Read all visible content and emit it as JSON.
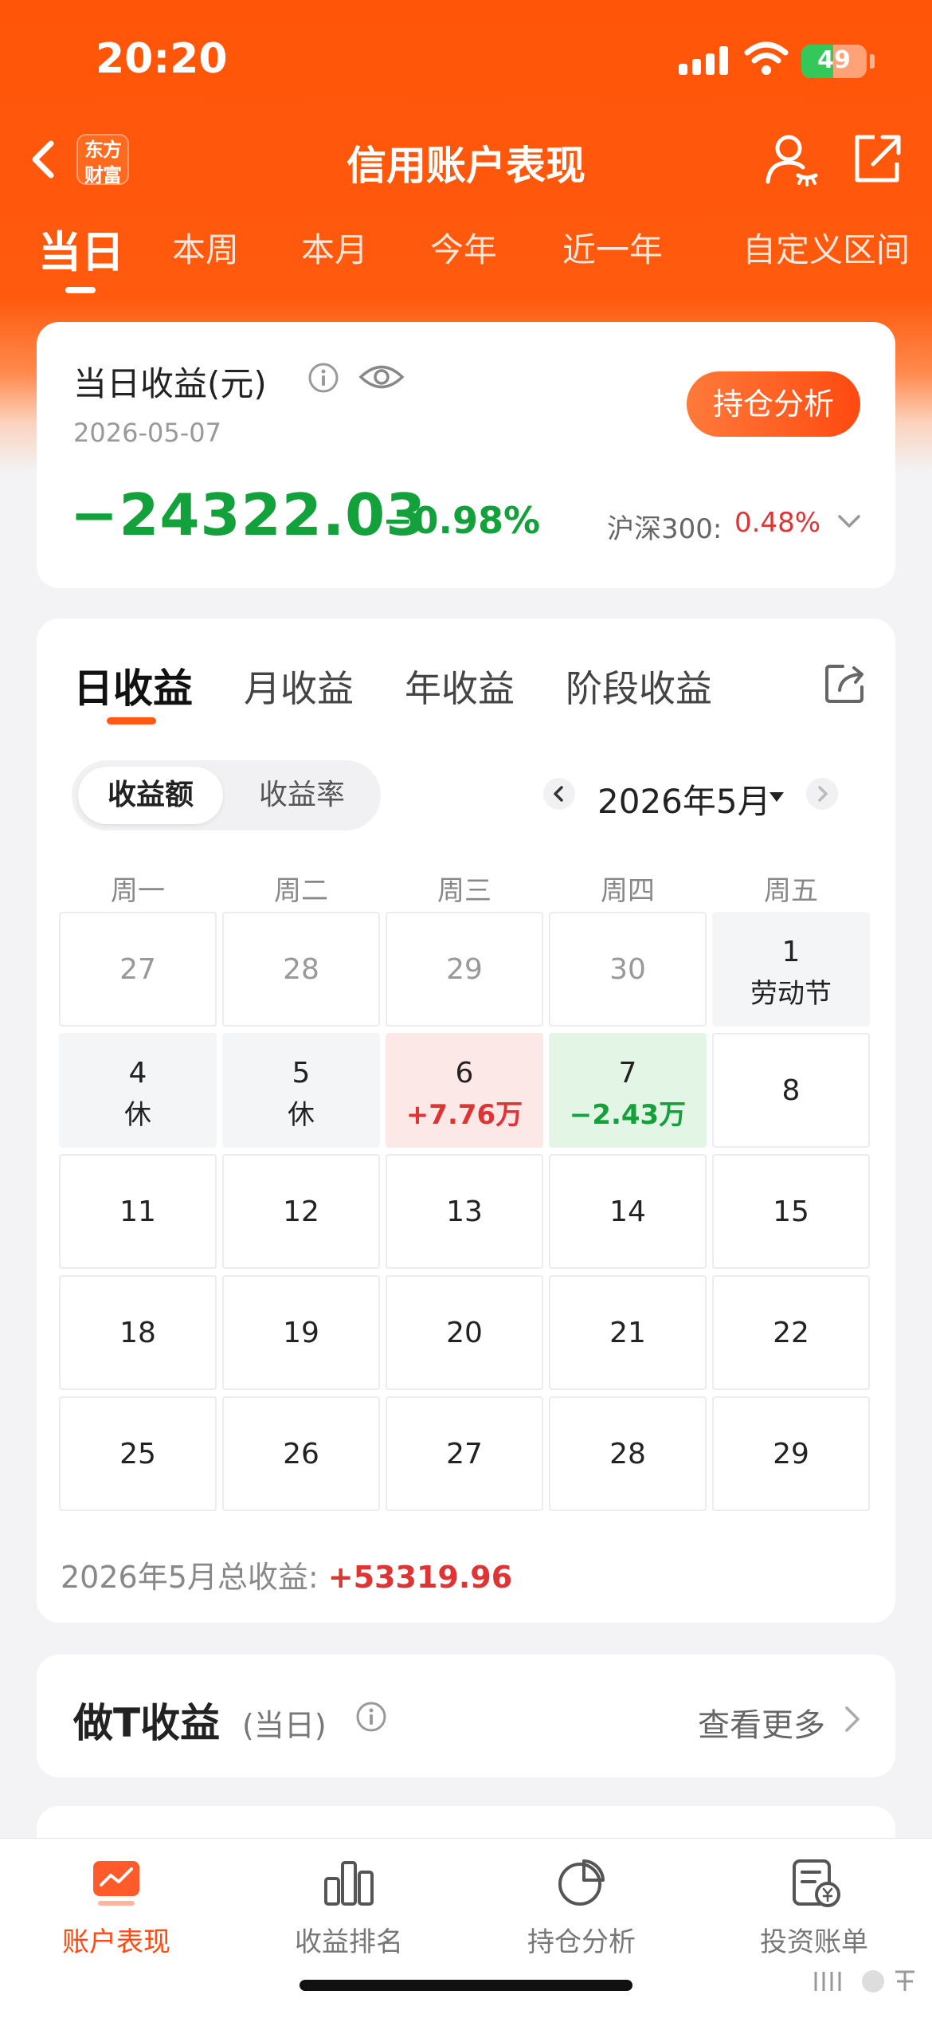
{
  "status_bar": {
    "time": "20:20",
    "battery_percent": "49"
  },
  "nav": {
    "logo_line1": "东方",
    "logo_line2": "财富",
    "title": "信用账户表现"
  },
  "period_tabs": [
    {
      "label": "当日",
      "active": true
    },
    {
      "label": "本周",
      "active": false
    },
    {
      "label": "本月",
      "active": false
    },
    {
      "label": "今年",
      "active": false
    },
    {
      "label": "近一年",
      "active": false
    },
    {
      "label": "自定义区间",
      "active": false
    }
  ],
  "summary": {
    "title": "当日收益(元)",
    "date": "2026-05-07",
    "analyze_button": "持仓分析",
    "amount": "−24322.03",
    "percent": "−0.98%",
    "benchmark_label": "沪深300:",
    "benchmark_value": "0.48%"
  },
  "returns": {
    "tabs": [
      {
        "label": "日收益",
        "active": true
      },
      {
        "label": "月收益",
        "active": false
      },
      {
        "label": "年收益",
        "active": false
      },
      {
        "label": "阶段收益",
        "active": false
      }
    ],
    "segment": [
      {
        "label": "收益额",
        "active": true
      },
      {
        "label": "收益率",
        "active": false
      }
    ],
    "month_label": "2026年5月",
    "weekdays": [
      "周一",
      "周二",
      "周三",
      "周四",
      "周五"
    ],
    "weeks": [
      [
        {
          "day": "27",
          "sub": "",
          "style": "muted"
        },
        {
          "day": "28",
          "sub": "",
          "style": "muted"
        },
        {
          "day": "29",
          "sub": "",
          "style": "muted"
        },
        {
          "day": "30",
          "sub": "",
          "style": "muted"
        },
        {
          "day": "1",
          "sub": "劳动节",
          "style": "grey"
        }
      ],
      [
        {
          "day": "4",
          "sub": "休",
          "style": "grey"
        },
        {
          "day": "5",
          "sub": "休",
          "style": "grey"
        },
        {
          "day": "6",
          "sub": "+7.76万",
          "style": "red"
        },
        {
          "day": "7",
          "sub": "−2.43万",
          "style": "green"
        },
        {
          "day": "8",
          "sub": "",
          "style": "normal"
        }
      ],
      [
        {
          "day": "11",
          "sub": "",
          "style": "normal"
        },
        {
          "day": "12",
          "sub": "",
          "style": "normal"
        },
        {
          "day": "13",
          "sub": "",
          "style": "normal"
        },
        {
          "day": "14",
          "sub": "",
          "style": "normal"
        },
        {
          "day": "15",
          "sub": "",
          "style": "normal"
        }
      ],
      [
        {
          "day": "18",
          "sub": "",
          "style": "normal"
        },
        {
          "day": "19",
          "sub": "",
          "style": "normal"
        },
        {
          "day": "20",
          "sub": "",
          "style": "normal"
        },
        {
          "day": "21",
          "sub": "",
          "style": "normal"
        },
        {
          "day": "22",
          "sub": "",
          "style": "normal"
        }
      ],
      [
        {
          "day": "25",
          "sub": "",
          "style": "normal"
        },
        {
          "day": "26",
          "sub": "",
          "style": "normal"
        },
        {
          "day": "27",
          "sub": "",
          "style": "normal"
        },
        {
          "day": "28",
          "sub": "",
          "style": "normal"
        },
        {
          "day": "29",
          "sub": "",
          "style": "normal"
        }
      ]
    ],
    "total_label": "2026年5月总收益:",
    "total_value": "+53319.96"
  },
  "t_trade": {
    "title": "做T收益",
    "subtitle": "(当日)",
    "more": "查看更多"
  },
  "tab_bar": [
    {
      "label": "账户表现",
      "icon": "trend-chart-icon",
      "active": true
    },
    {
      "label": "收益排名",
      "icon": "bar-chart-icon",
      "active": false
    },
    {
      "label": "持仓分析",
      "icon": "pie-chart-icon",
      "active": false
    },
    {
      "label": "投资账单",
      "icon": "bill-icon",
      "active": false
    }
  ],
  "colors": {
    "brand": "#ff5509",
    "gain": "#e03434",
    "loss": "#12a13a"
  }
}
